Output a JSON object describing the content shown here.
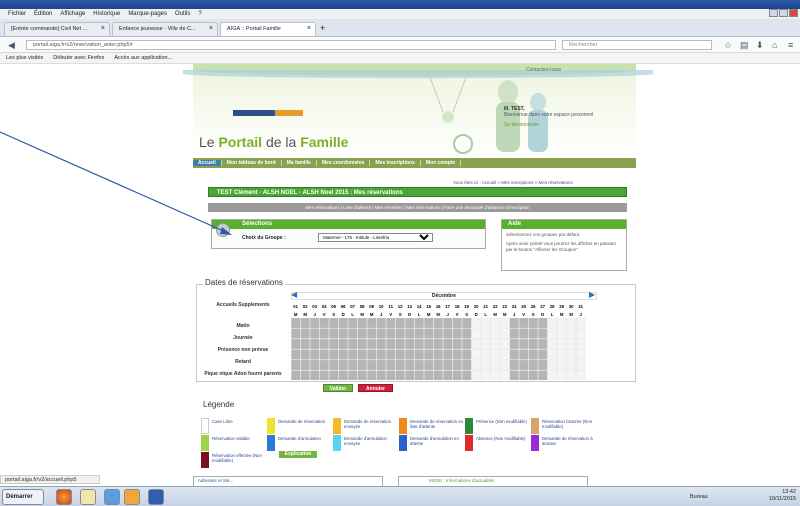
{
  "browser": {
    "menu": [
      "Fichier",
      "Édition",
      "Affichage",
      "Historique",
      "Marque-pages",
      "Outils",
      "?"
    ],
    "tabs": [
      {
        "label": "[Entrée commande] Civil Net ..."
      },
      {
        "label": "Enfance jeunesse - Ville de C..."
      },
      {
        "label": "AIGA :: Portail Famille"
      }
    ],
    "new_tab": "+",
    "url": "portail.aiga.fr/v2/reservation_anier.php5#",
    "search_placeholder": "Rechercher",
    "bookmarks": [
      "Les plus visités",
      "Débuter avec Firefox",
      "Accès aux application..."
    ],
    "status_url": "portail.aiga.fr/v2/accueil.php5"
  },
  "site": {
    "contact": "Contactez-nous",
    "title_pre": "Le",
    "title_portail": "Portail",
    "title_mid": "de la",
    "title_famille": "Famille",
    "user_name": "M. TEST,",
    "user_welcome": "Bienvenue dans votre espace personnel",
    "logout": "Se déconnecter",
    "nav": [
      "Accueil",
      "Mon tableau de bord",
      "Ma famille",
      "Mes coordonnées",
      "Mes inscriptions",
      "Mon compte"
    ],
    "breadcrumb": "Vous êtes ici : Accueil » Mes inscriptions » Mes réservations",
    "resa_title": "TEST Clément - ALSH NOEL - ALSH Noel 2015 : Mes réservations",
    "subnav": "Mes réservations | Liste d'attente | Mes éventites | Mes informations | Faire une demande d'absence d'inscription",
    "selections_title": "Sélections",
    "groupe_label": "Choix du Groupe :",
    "groupe_value": "Maternel - 175 - Intitule - Lisrefrio",
    "aide_title": "Aide",
    "aide_p1": "Sélectionnez vos groupes par défaut.",
    "aide_p2": "Après avoir pointé vous pourrez les afficher en passant par le bouton \"Affecter les Groupes\"",
    "dates_title": "Dates de réservations",
    "month": "Décembre",
    "rows": [
      "Accueils Supplements",
      "Matin",
      "Journée",
      "Présence non prévue",
      "Retard",
      "Pique nique Adon fourni parents"
    ],
    "days": [
      "01",
      "02",
      "03",
      "04",
      "05",
      "06",
      "07",
      "08",
      "09",
      "10",
      "11",
      "12",
      "13",
      "14",
      "15",
      "16",
      "17",
      "18",
      "19",
      "20",
      "21",
      "22",
      "23",
      "24",
      "25",
      "26",
      "27",
      "28",
      "29",
      "30",
      "31"
    ],
    "dow": [
      "M",
      "M",
      "J",
      "V",
      "S",
      "D",
      "L",
      "M",
      "M",
      "J",
      "V",
      "S",
      "D",
      "L",
      "M",
      "M",
      "J",
      "V",
      "S",
      "D",
      "L",
      "M",
      "M",
      "J",
      "V",
      "S",
      "D",
      "L",
      "M",
      "M",
      "J"
    ],
    "valider": "Valider",
    "annuler": "Annuler",
    "legende_title": "Légende",
    "legend": [
      {
        "label": "Case Libre",
        "color": "#ffffff"
      },
      {
        "label": "Demande de réservation",
        "color": "#f2e22d"
      },
      {
        "label": "Demande de réservation envoyée",
        "color": "#f7b92b"
      },
      {
        "label": "Demande de réservation en liste d'attente",
        "color": "#f08a1c"
      },
      {
        "label": "Présence (Non modifiable)",
        "color": "#2a8a3a"
      },
      {
        "label": "Réservation facturée (Non modifiable)",
        "color": "#d6a56c"
      },
      {
        "label": "Réservation validée",
        "color": "#9bd34b"
      },
      {
        "label": "Demande d'annulation",
        "color": "#2a7bd6"
      },
      {
        "label": "Demande d'annulation envoyée",
        "color": "#5ad3f0"
      },
      {
        "label": "Demande d'annulation en attente",
        "color": "#2f5fc8"
      },
      {
        "label": "Absence (Non modifiable)",
        "color": "#e02a2a"
      },
      {
        "label": "Demande de réservation à annuler",
        "color": "#9a2ad6"
      },
      {
        "label": "Réservation effectée (Non modifiable)",
        "color": "#7a1020"
      }
    ],
    "explication": "Explication",
    "bottom_box1": "Adresses et Siè...",
    "bottom_box2": "MENU : Informations d'actualités"
  },
  "taskbar": {
    "start": "Démarrer",
    "bureau": "Bureau",
    "time": "13:42",
    "date": "10/11/2015"
  },
  "colors": {
    "accent_green": "#59b02f",
    "nav_green": "#8aa24f",
    "cell_grey": "#b5b5b5"
  }
}
